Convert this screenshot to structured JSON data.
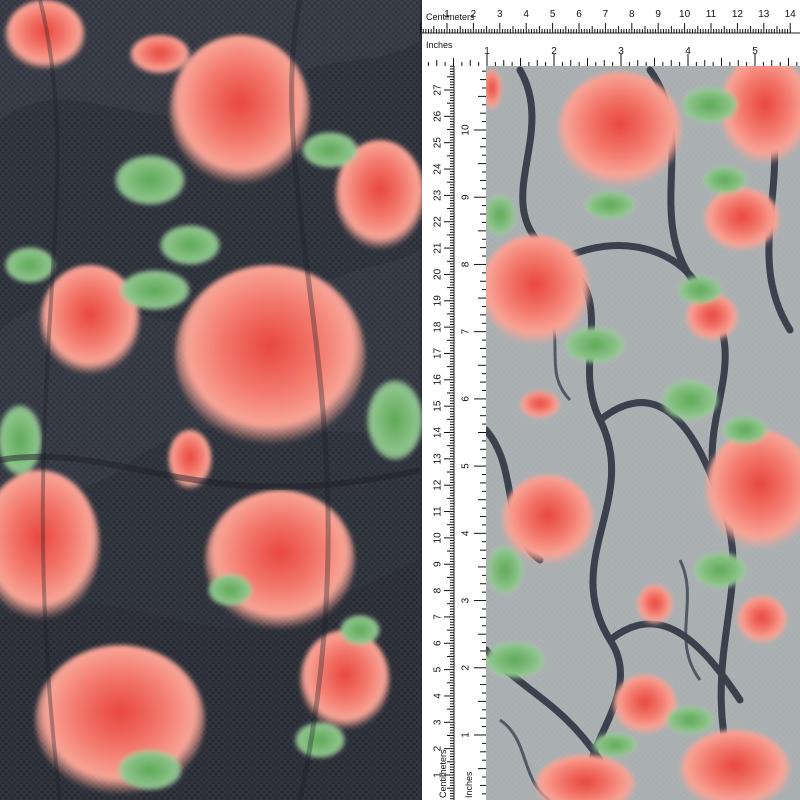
{
  "image": {
    "subject": "floral lace fabric",
    "colors": {
      "base": "#2e333d",
      "rose": "#f0706a",
      "rose_light": "#f7a49a",
      "leaf": "#4f9a4a",
      "mint": "#b9dcc0",
      "ruler": "#ffffff"
    }
  },
  "rulers": {
    "top": {
      "title_cm": "Centimeters",
      "title_in": "Inches",
      "cm_labels": [
        "1",
        "2",
        "3",
        "4",
        "5",
        "6",
        "7",
        "8",
        "9",
        "10",
        "11",
        "12",
        "13",
        "14"
      ],
      "in_labels": [
        "1",
        "2",
        "3",
        "4",
        "5"
      ]
    },
    "side": {
      "title_cm": "Centimeters",
      "title_in": "Inches",
      "cm_labels": [
        "27",
        "26",
        "25",
        "24",
        "23",
        "22",
        "21",
        "20",
        "19",
        "18",
        "17",
        "16",
        "15",
        "14",
        "13",
        "12",
        "11",
        "10",
        "9",
        "8",
        "7",
        "6",
        "5",
        "4",
        "3",
        "2",
        "1"
      ],
      "in_labels": [
        "10",
        "9",
        "8",
        "7",
        "6",
        "5",
        "4",
        "3",
        "2",
        "1"
      ]
    }
  }
}
